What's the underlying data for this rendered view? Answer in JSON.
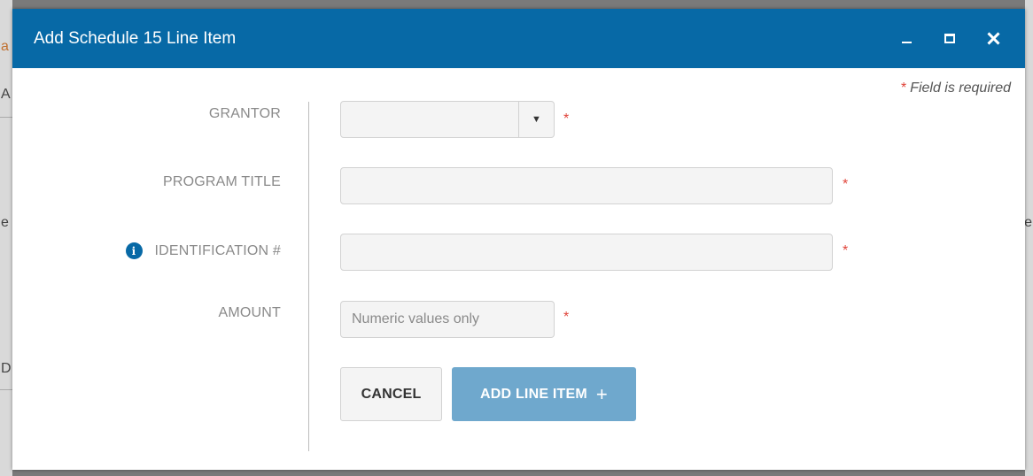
{
  "background": {
    "fragments": [
      "a",
      "A",
      "e",
      "D",
      "e"
    ]
  },
  "dialog": {
    "title": "Add Schedule 15 Line Item",
    "controls": {
      "minimize_icon": "minimize-icon",
      "maximize_icon": "maximize-icon",
      "close_icon": "close-icon"
    },
    "required_note": {
      "star": "*",
      "text": "Field is required"
    }
  },
  "form": {
    "grantor": {
      "label": "GRANTOR",
      "value": "",
      "required_star": "*"
    },
    "program_title": {
      "label": "PROGRAM TITLE",
      "value": "",
      "required_star": "*"
    },
    "identification": {
      "label": "IDENTIFICATION #",
      "info_glyph": "i",
      "value": "",
      "required_star": "*"
    },
    "amount": {
      "label": "AMOUNT",
      "placeholder": "Numeric values only",
      "required_star": "*"
    }
  },
  "buttons": {
    "cancel": "CANCEL",
    "add_line_item": "ADD LINE ITEM",
    "add_plus": "+"
  },
  "colors": {
    "titlebar": "#0769a6",
    "primary_button": "#6fa8cd",
    "required": "#e0443a"
  }
}
